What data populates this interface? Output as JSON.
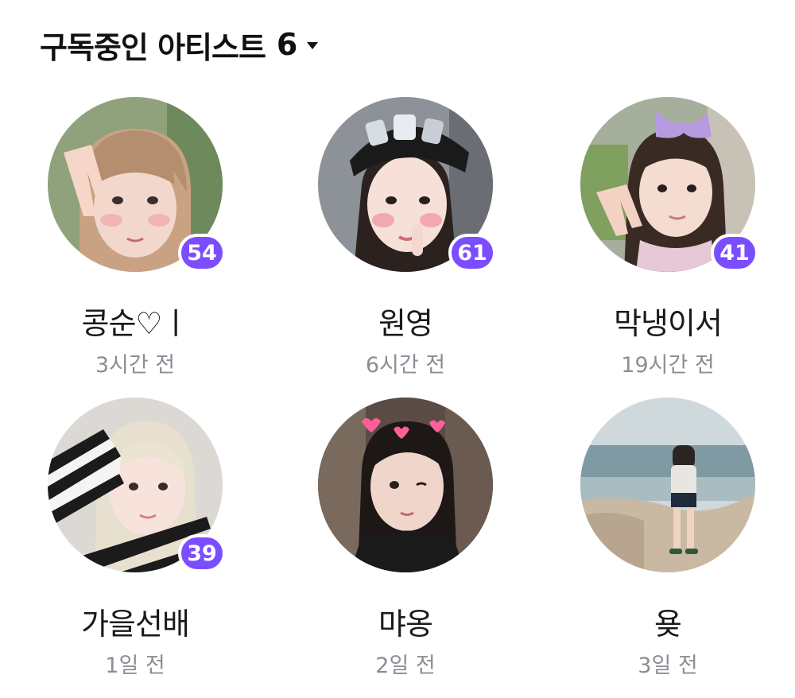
{
  "header": {
    "title": "구독중인 아티스트",
    "count": "6"
  },
  "artists": [
    {
      "name": "콩순♡ㅣ",
      "time": "3시간 전",
      "badge": "54",
      "photo_icon": "artist-photo",
      "bg": "#b9a593"
    },
    {
      "name": "원영",
      "time": "6시간 전",
      "badge": "61",
      "photo_icon": "artist-photo",
      "bg": "#8c8f96"
    },
    {
      "name": "막냉이서",
      "time": "19시간 전",
      "badge": "41",
      "photo_icon": "artist-photo",
      "bg": "#a8b29a"
    },
    {
      "name": "가을선배",
      "time": "1일 전",
      "badge": "39",
      "photo_icon": "artist-photo",
      "bg": "#d9d4cf"
    },
    {
      "name": "먀옹",
      "time": "2일 전",
      "badge": "",
      "photo_icon": "artist-photo",
      "bg": "#4a3f3b"
    },
    {
      "name": "욪",
      "time": "3일 전",
      "badge": "",
      "photo_icon": "artist-photo",
      "bg": "#b7c3c6"
    }
  ],
  "colors": {
    "badge": "#7a4dff",
    "time_text": "#8a8e94"
  }
}
